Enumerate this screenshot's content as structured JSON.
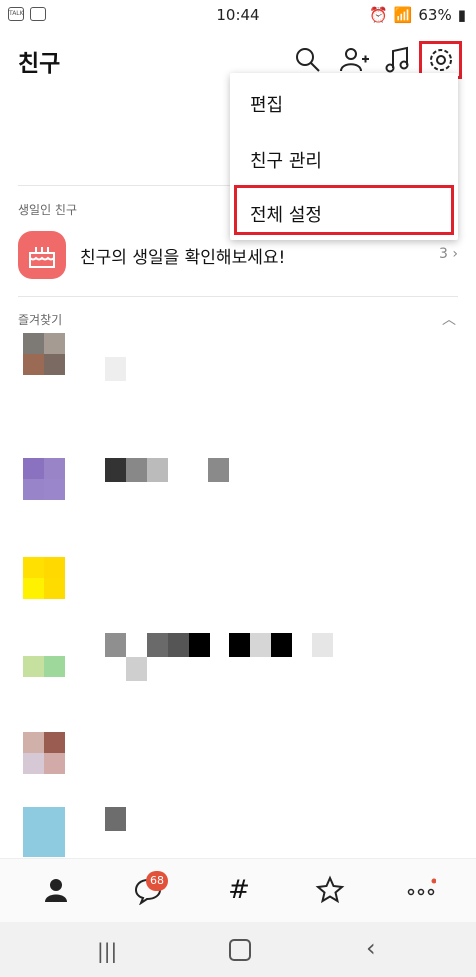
{
  "status_bar": {
    "time": "10:44",
    "battery": "63%",
    "left_icons": [
      "talk-notification-icon",
      "gallery-notification-icon"
    ]
  },
  "header": {
    "title": "친구",
    "icons": [
      "search-icon",
      "add-friend-icon",
      "music-icon",
      "settings-icon"
    ]
  },
  "sections": {
    "birthday": {
      "label": "생일인 친구",
      "text": "친구의 생일을 확인해보세요!",
      "count": "3"
    },
    "favorites": {
      "label": "즐겨찾기"
    }
  },
  "menu": {
    "items": [
      "편집",
      "친구 관리",
      "전체 설정"
    ],
    "highlighted": "전체 설정"
  },
  "bottom_nav": {
    "items": [
      "friends-icon",
      "chat-icon",
      "hashtag-icon",
      "star-icon",
      "more-icon"
    ],
    "chat_badge": "68"
  },
  "colors": {
    "highlight": "#e0202a",
    "badge": "#e2513a",
    "birthday": "#f06a6a"
  }
}
